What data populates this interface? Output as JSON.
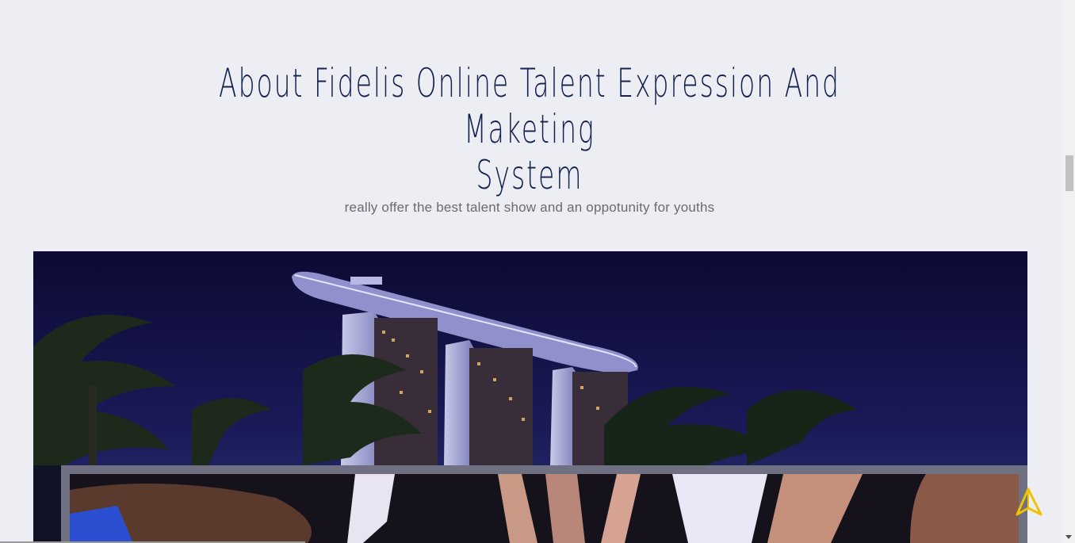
{
  "about": {
    "title_line1": "About Fidelis Online Talent Expression And Maketing",
    "title_line2": "System",
    "subtitle": "really offer the best talent show and an oppotunity for youths"
  },
  "colors": {
    "background": "#eceef3",
    "title": "#13224f",
    "subtitle": "#6b6b6b",
    "accent_icon": "#f2c200"
  },
  "icons": {
    "back_to_top": "navigation-arrow-icon"
  }
}
